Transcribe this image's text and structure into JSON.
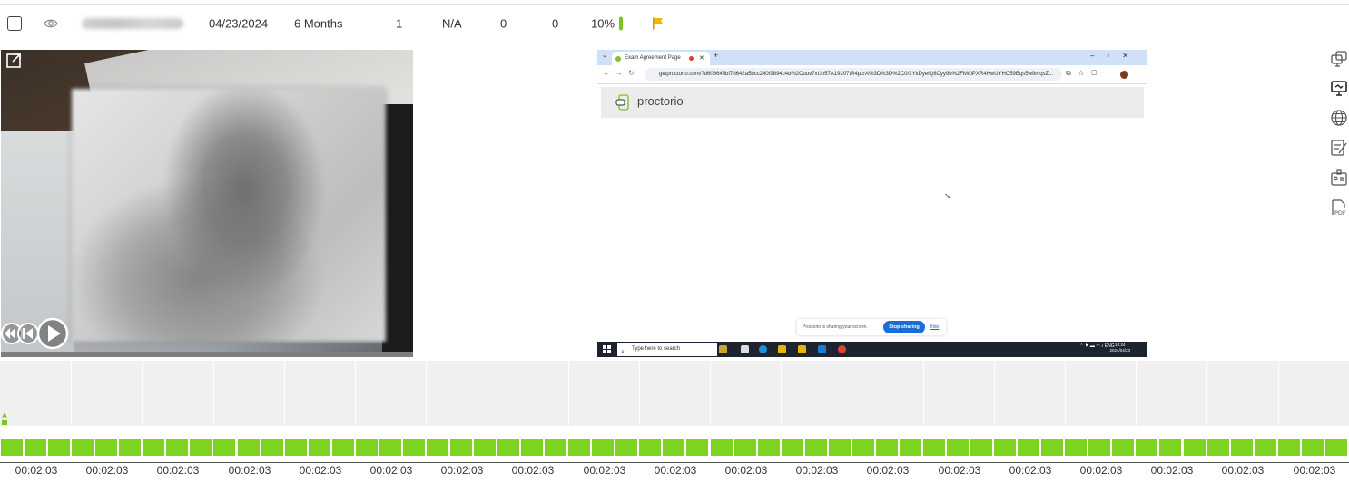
{
  "summary_row": {
    "date": "04/23/2024",
    "duration": "6 Months",
    "count": "1",
    "na_value": "N/A",
    "zero_a": "0",
    "zero_b": "0",
    "percent": "10%",
    "percent_value": 0.1,
    "percent_color": "#7ec128",
    "flag_color": "#f5b400"
  },
  "screen": {
    "tab_title": "Exam Agreement Page",
    "url": "getproctorio.com/?d603645bf7d642a5bcc240f9894c4d%2Cuuv7xUp57A19207tR4pzrA%3D%3D%2C0/1YkDyelQ8Cyy9b%2FMt0PXR4HwUYHC59Eqs5w9mqsZ...",
    "brand": "proctorio",
    "share_message": "Proctorio is sharing your screen.",
    "stop_sharing_label": "Stop sharing",
    "hide_label": "Hide",
    "taskbar_search": "Type here to search",
    "tray_lang": "ENG",
    "tray_time": "10:24",
    "tray_date": "2024/04/23"
  },
  "side_tools": [
    "copy-screen-icon",
    "monitor-icon",
    "globe-icon",
    "notes-icon",
    "id-card-icon",
    "pdf-icon"
  ],
  "timeline": {
    "labels": [
      "00:02:03",
      "00:02:03",
      "00:02:03",
      "00:02:03",
      "00:02:03",
      "00:02:03",
      "00:02:03",
      "00:02:03",
      "00:02:03",
      "00:02:03",
      "00:02:03",
      "00:02:03",
      "00:02:03",
      "00:02:03",
      "00:02:03",
      "00:02:03",
      "00:02:03",
      "00:02:03",
      "00:02:03"
    ],
    "segment_color": "#7ed321"
  }
}
